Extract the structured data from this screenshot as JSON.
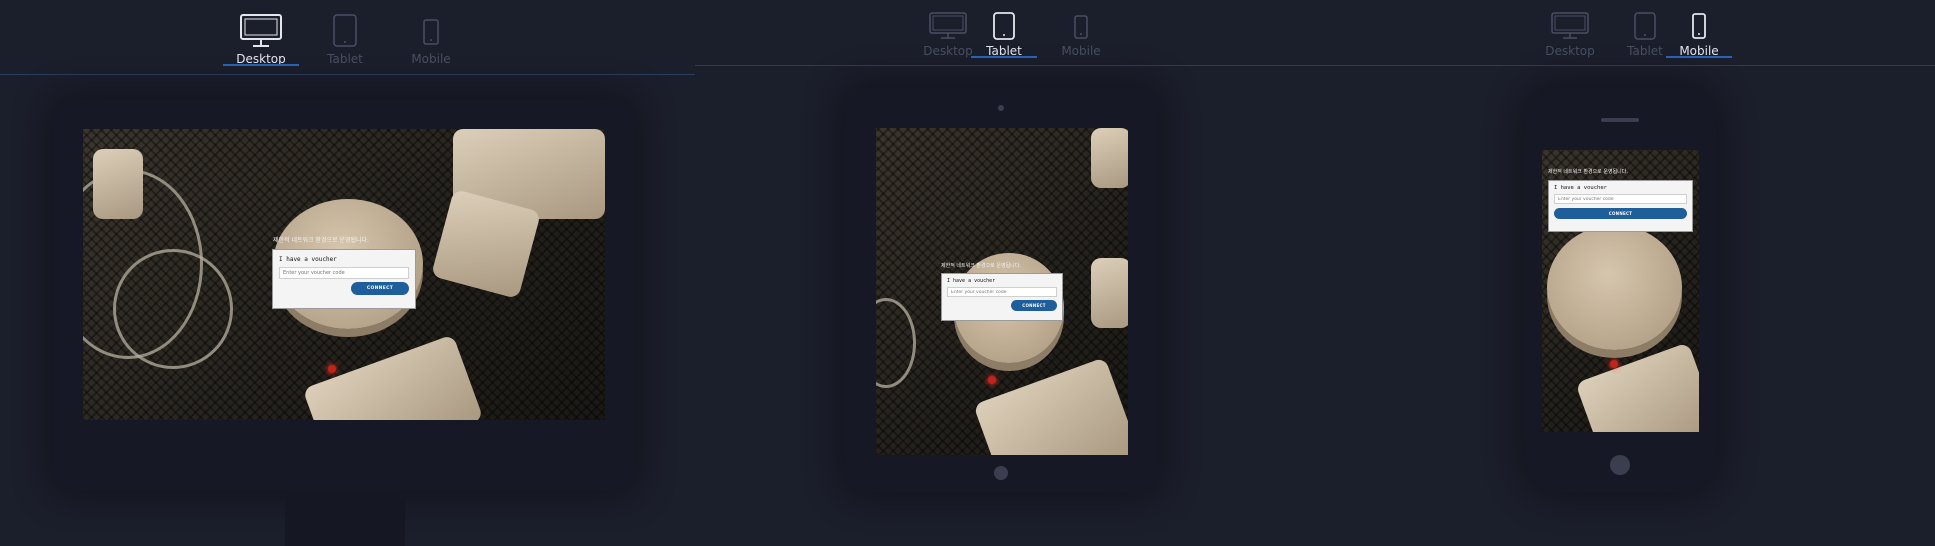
{
  "tabs": {
    "desktop": "Desktop",
    "tablet": "Tablet",
    "mobile": "Mobile"
  },
  "panels": [
    {
      "view": "Desktop",
      "active_tab": "desktop"
    },
    {
      "view": "Tablet",
      "active_tab": "tablet"
    },
    {
      "view": "Mobile",
      "active_tab": "mobile"
    }
  ],
  "portal": {
    "heading": "제한적 네트워크 환경으로 운영됩니다.",
    "voucher_label": "I have a voucher",
    "voucher_placeholder": "Enter your voucher code",
    "connect_label": "CONNECT"
  },
  "colors": {
    "background": "#1b1e2b",
    "active_tab_underline": "#2a64b8",
    "connect_button": "#1e5f9b"
  },
  "icons": [
    "desktop-icon",
    "tablet-icon",
    "mobile-icon"
  ]
}
